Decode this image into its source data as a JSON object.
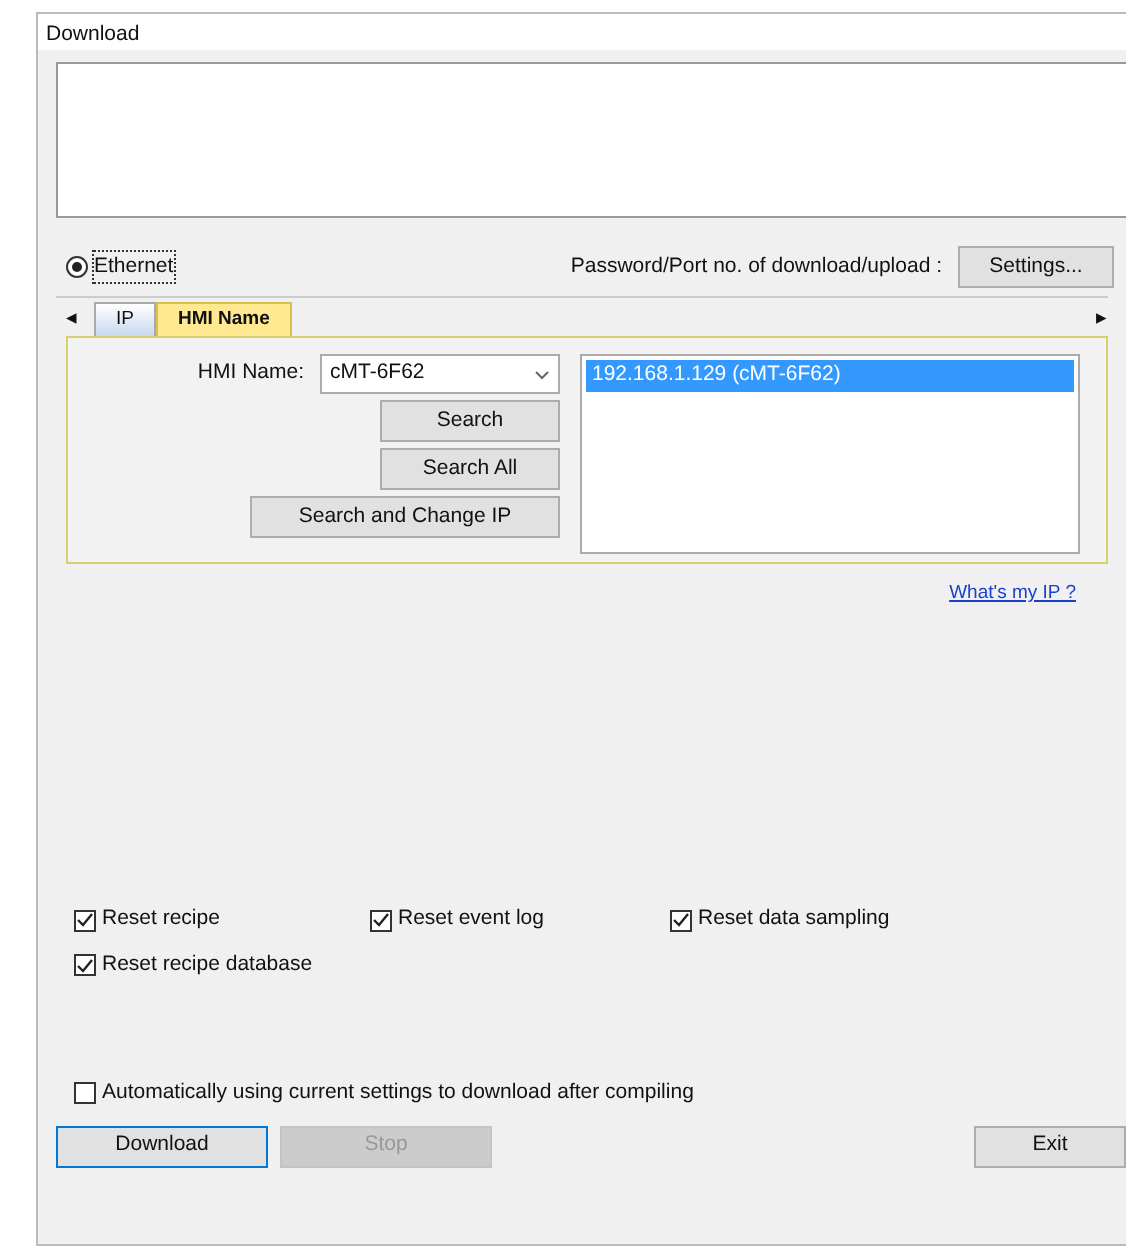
{
  "window": {
    "title": "Download"
  },
  "connection": {
    "label": "Ethernet",
    "selected": true
  },
  "password_label": "Password/Port no. of download/upload :",
  "settings_button": "Settings...",
  "tab_prev": "◂",
  "tab_next": "▸",
  "tabs": [
    {
      "label": "IP",
      "selected": false
    },
    {
      "label": "HMI Name",
      "selected": true
    }
  ],
  "hmi_name": {
    "label": "HMI Name:",
    "value": "cMT-6F62"
  },
  "search_buttons": [
    "Search",
    "Search All",
    "Search and Change IP"
  ],
  "devices": [
    {
      "label": "192.168.1.129 (cMT-6F62)",
      "selected": true
    }
  ],
  "whats_my_ip": "What's my IP ?",
  "reset_options": [
    {
      "label": "Reset recipe",
      "checked": true
    },
    {
      "label": "Reset event log",
      "checked": true
    },
    {
      "label": "Reset data sampling",
      "checked": true
    },
    {
      "label": "Reset recipe database",
      "checked": true
    }
  ],
  "auto_download": {
    "label": "Automatically using current settings to download after compiling",
    "checked": false
  },
  "buttons": [
    {
      "label": "Download",
      "disabled": false
    },
    {
      "label": "Stop",
      "disabled": true
    },
    {
      "label": "Exit",
      "disabled": false
    }
  ]
}
